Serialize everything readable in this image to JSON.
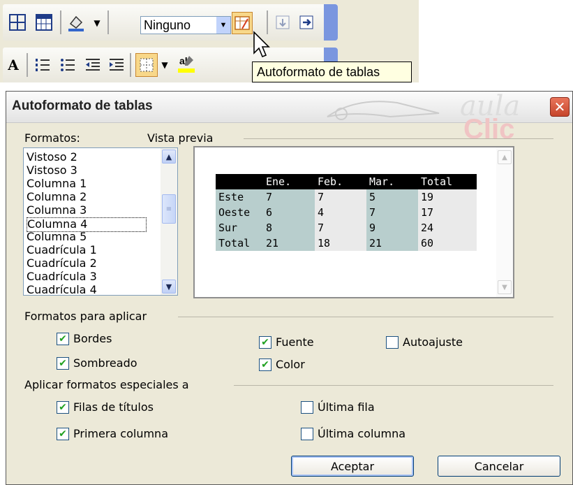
{
  "toolbar": {
    "border_combo_value": "Ninguno",
    "tooltip": "Autoformato de tablas"
  },
  "dialog": {
    "title": "Autoformato de tablas",
    "logo_text": "aula",
    "logo_text2": "Clic",
    "formats_label": "Formatos:",
    "preview_label": "Vista previa",
    "formats": [
      "Vistoso 2",
      "Vistoso 3",
      "Columna 1",
      "Columna 2",
      "Columna 3",
      "Columna 4",
      "Columna 5",
      "Cuadrícula 1",
      "Cuadrícula 2",
      "Cuadrícula 3",
      "Cuadrícula 4"
    ],
    "selected_format": "Columna 4",
    "preview_table": {
      "header": [
        "",
        "Ene.",
        "Feb.",
        "Mar.",
        "Total"
      ],
      "rows": [
        [
          "Este",
          "7",
          "7",
          "5",
          "19"
        ],
        [
          "Oeste",
          "6",
          "4",
          "7",
          "17"
        ],
        [
          "Sur",
          "8",
          "7",
          "9",
          "24"
        ],
        [
          "Total",
          "21",
          "18",
          "21",
          "60"
        ]
      ]
    },
    "apply_group_label": "Formatos para aplicar",
    "apply_options": {
      "bordes": {
        "label": "Bordes",
        "checked": true
      },
      "fuente": {
        "label": "Fuente",
        "checked": true
      },
      "autoajuste": {
        "label": "Autoajuste",
        "checked": false
      },
      "sombreado": {
        "label": "Sombreado",
        "checked": true
      },
      "color": {
        "label": "Color",
        "checked": true
      }
    },
    "special_group_label": "Aplicar formatos especiales a",
    "special_options": {
      "filas_titulos": {
        "label": "Filas de títulos",
        "checked": true
      },
      "ultima_fila": {
        "label": "Última fila",
        "checked": false
      },
      "primera_columna": {
        "label": "Primera columna",
        "checked": true
      },
      "ultima_columna": {
        "label": "Última columna",
        "checked": false
      }
    },
    "ok_label": "Aceptar",
    "cancel_label": "Cancelar"
  }
}
